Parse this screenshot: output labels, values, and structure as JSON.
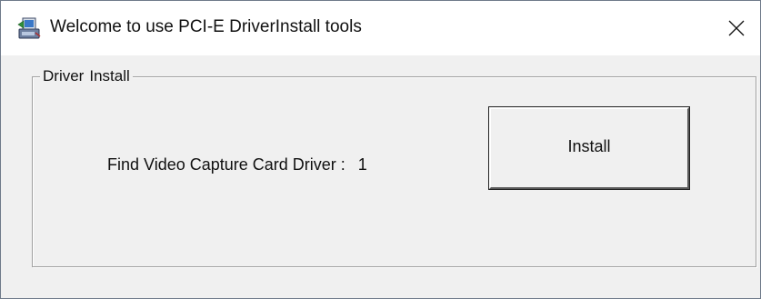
{
  "window": {
    "title": "Welcome to use PCI-E DriverInstall tools",
    "app_icon": "installer-computer-icon",
    "close_icon": "close-icon"
  },
  "group": {
    "legend_word1": "Driver",
    "legend_word2": "Install"
  },
  "status": {
    "label": "Find  Video Capture Card Driver :",
    "value": "1"
  },
  "buttons": {
    "install_label": "Install"
  }
}
